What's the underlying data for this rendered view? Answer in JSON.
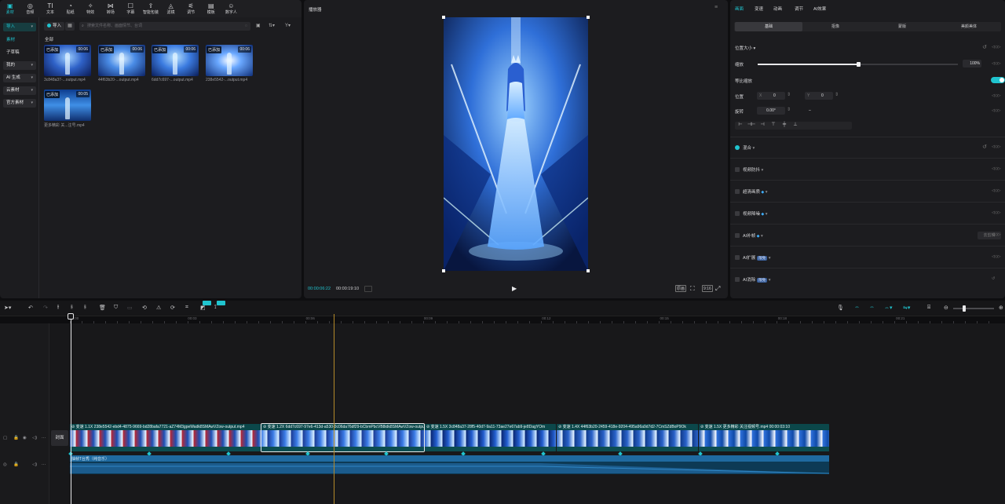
{
  "toolbar": {
    "tools": [
      {
        "icon": "media-icon",
        "glyph": "▣",
        "label": "素材",
        "active": true
      },
      {
        "icon": "audio-icon",
        "glyph": "◎",
        "label": "音频"
      },
      {
        "icon": "text-icon",
        "glyph": "TI",
        "label": "文本"
      },
      {
        "icon": "sticker-icon",
        "glyph": "◔",
        "label": "贴纸"
      },
      {
        "icon": "effects-icon",
        "glyph": "✧",
        "label": "特效"
      },
      {
        "icon": "transition-icon",
        "glyph": "⋈",
        "label": "转场"
      },
      {
        "icon": "subtitle-icon",
        "glyph": "☐",
        "label": "字幕"
      },
      {
        "icon": "smart-package-icon",
        "glyph": "⇪",
        "label": "智能包装"
      },
      {
        "icon": "filter-icon",
        "glyph": "◬",
        "label": "滤镜"
      },
      {
        "icon": "adjust-icon",
        "glyph": "⚟",
        "label": "调节"
      },
      {
        "icon": "template-icon",
        "glyph": "▤",
        "label": "模板"
      },
      {
        "icon": "digital-human-icon",
        "glyph": "☺",
        "label": "数字人"
      }
    ]
  },
  "sidebar": {
    "import_label": "导入",
    "items": [
      {
        "label": "素材",
        "selected": true
      },
      {
        "label": "子草稿"
      },
      {
        "label": "我的",
        "caret": true
      },
      {
        "label": "AI 生成",
        "caret": true
      },
      {
        "label": "云素材",
        "caret": true
      },
      {
        "label": "官方素材",
        "caret": true
      }
    ]
  },
  "media": {
    "import_button": "导入",
    "search_placeholder": "搜索文件名称、画面情节、台词",
    "section_label": "全部",
    "items": [
      {
        "badge": "已添加",
        "duration": "00:06",
        "name": "3c848a37-...output.mp4"
      },
      {
        "badge": "已添加",
        "duration": "00:06",
        "name": "44f63b20-...output.mp4"
      },
      {
        "badge": "已添加",
        "duration": "00:06",
        "name": "6dd7c697-...output.mp4"
      },
      {
        "badge": "已添加",
        "duration": "00:06",
        "name": "238e5542-...output.mp4"
      },
      {
        "badge": "已添加",
        "duration": "00:05",
        "name": "更多精彩 关...注号.mp4"
      }
    ]
  },
  "player": {
    "title": "播放器",
    "current_time": "00:00:06:22",
    "total_time": "00:00:19:10",
    "ratio_label": "9:16",
    "quality_label": "原画"
  },
  "inspector": {
    "tabs": [
      {
        "label": "画面",
        "selected": true
      },
      {
        "label": "变速"
      },
      {
        "label": "动画"
      },
      {
        "label": "调节"
      },
      {
        "label": "AI效果"
      }
    ],
    "subtabs": [
      {
        "label": "基础",
        "selected": true
      },
      {
        "label": "抠像"
      },
      {
        "label": "蒙版"
      },
      {
        "label": "美颜美体"
      }
    ],
    "position_size": "位置大小",
    "scale_label": "缩放",
    "scale_value": "100%",
    "scale_fraction": 0.5,
    "uniform_scale": "等比缩放",
    "position_label": "位置",
    "x_label": "X",
    "x_value": "0",
    "y_label": "Y",
    "y_value": "0",
    "rotate_label": "旋转",
    "rotate_value": "0.00°",
    "rotate_dash": "–",
    "sections": [
      {
        "label": "混合",
        "checked": true,
        "caret": true
      },
      {
        "label": "视频防抖",
        "caret": true
      },
      {
        "label": "超清画质",
        "gem": true,
        "caret": true
      },
      {
        "label": "视频降噪",
        "gem": true,
        "caret": true
      },
      {
        "label": "AI补帧",
        "gem": true,
        "caret": true,
        "button": "去剪辑"
      },
      {
        "label": "AI扩展",
        "badge": "限免",
        "caret": true
      },
      {
        "label": "AI消除",
        "badge": "限免",
        "caret": true
      }
    ]
  },
  "timeline": {
    "ticks": [
      "00:00",
      "00:03",
      "00:06",
      "00:09",
      "00:12",
      "00:15",
      "00:18",
      "00:21"
    ],
    "cover_label": "封面",
    "clips": [
      {
        "speed": "变速 1.1X",
        "name": "238e5542-ebd4-4875-9669-bd28bafa7721-aZ74M3gpeWadk8SMAwVZow-output.mp4"
      },
      {
        "speed": "变速 1.2X",
        "name": "6dd7c697-97e6-413d-a530-0c06da76df29-bCbmPbcVB8idk8SMAwVZow-output.mp4",
        "selected": true
      },
      {
        "speed": "变速 1.5X",
        "name": "3c848a37-28f5-40d7-9a11-73ae27e67ab9-je8DagYOm"
      },
      {
        "speed": "变速 1.4X",
        "name": "44f63b20-2459-418e-9204-495a96a9d7d2-7CmSZdBoP9Ok"
      },
      {
        "speed": "变速 1.5X",
        "name": "更多精彩 关注视频号.mp4  00:00:03:10"
      }
    ],
    "audio_label": "抽帧T台秀（纯音乐）"
  }
}
